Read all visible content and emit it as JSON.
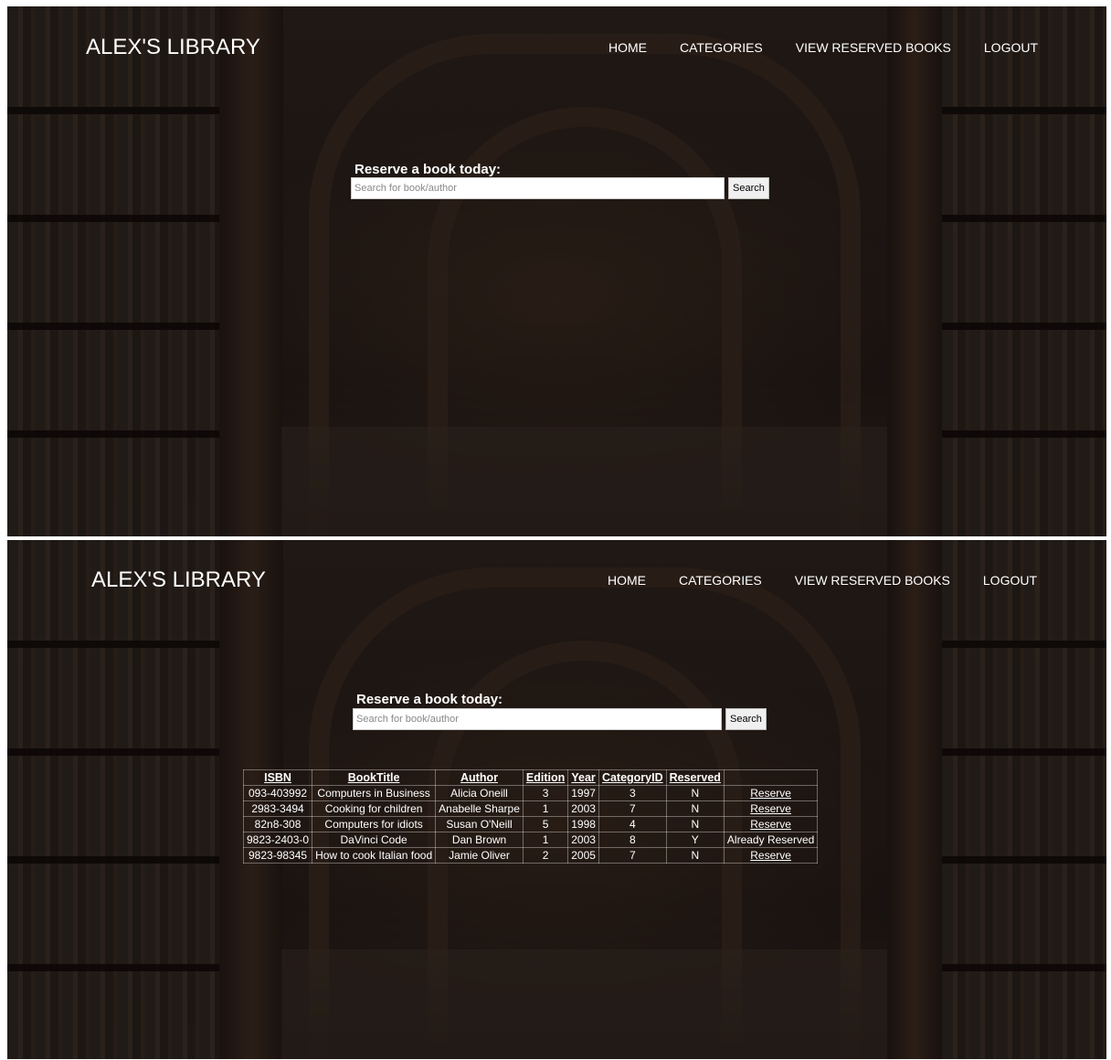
{
  "brand": "ALEX'S LIBRARY",
  "nav": [
    "HOME",
    "CATEGORIES",
    "VIEW RESERVED BOOKS",
    "LOGOUT"
  ],
  "search": {
    "title": "Reserve a book today:",
    "placeholder": "Search for book/author",
    "button": "Search"
  },
  "table": {
    "headers": [
      "ISBN",
      "BookTitle",
      "Author",
      "Edition",
      "Year",
      "CategoryID",
      "Reserved"
    ],
    "rows": [
      {
        "isbn": "093-403992",
        "title": "Computers in Business",
        "author": "Alicia Oneill",
        "edition": "3",
        "year": "1997",
        "category": "3",
        "reserved": "N",
        "action": "Reserve"
      },
      {
        "isbn": "2983-3494",
        "title": "Cooking for children",
        "author": "Anabelle Sharpe",
        "edition": "1",
        "year": "2003",
        "category": "7",
        "reserved": "N",
        "action": "Reserve"
      },
      {
        "isbn": "82n8-308",
        "title": "Computers for idiots",
        "author": "Susan O'Neill",
        "edition": "5",
        "year": "1998",
        "category": "4",
        "reserved": "N",
        "action": "Reserve"
      },
      {
        "isbn": "9823-2403-0",
        "title": "DaVinci Code",
        "author": "Dan Brown",
        "edition": "1",
        "year": "2003",
        "category": "8",
        "reserved": "Y",
        "action": "Already Reserved"
      },
      {
        "isbn": "9823-98345",
        "title": "How to cook Italian food",
        "author": "Jamie Oliver",
        "edition": "2",
        "year": "2005",
        "category": "7",
        "reserved": "N",
        "action": "Reserve"
      }
    ]
  }
}
